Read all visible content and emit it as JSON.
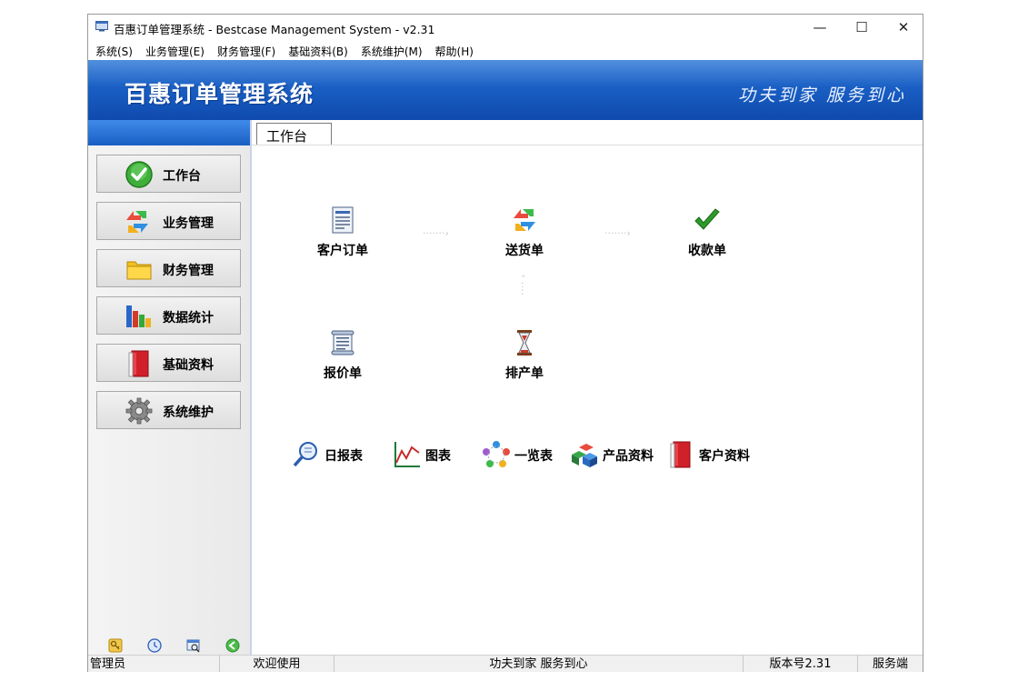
{
  "window": {
    "title": "百惠订单管理系统 - Bestcase Management System - v2.31",
    "controls": {
      "minimize": "—",
      "maximize": "☐",
      "close": "✕"
    }
  },
  "menu": [
    "系统(S)",
    "业务管理(E)",
    "财务管理(F)",
    "基础资料(B)",
    "系统维护(M)",
    "帮助(H)"
  ],
  "banner": {
    "title": "百惠订单管理系统",
    "slogan": "功夫到家 服务到心"
  },
  "sidebar": {
    "items": [
      {
        "label": "工作台",
        "icon": "check-circle-icon"
      },
      {
        "label": "业务管理",
        "icon": "exchange-arrows-icon"
      },
      {
        "label": "财务管理",
        "icon": "folder-icon"
      },
      {
        "label": "数据统计",
        "icon": "bar-chart-icon"
      },
      {
        "label": "基础资料",
        "icon": "red-book-icon"
      },
      {
        "label": "系统维护",
        "icon": "gear-icon"
      }
    ],
    "bottom_icons": [
      "key-icon",
      "clock-icon",
      "search-window-icon",
      "back-arrow-icon"
    ]
  },
  "workspace": {
    "tab": "工作台",
    "flow": {
      "customer_order": "客户订单",
      "delivery_note": "送货单",
      "receipt": "收款单",
      "quotation": "报价单",
      "production": "排产单"
    },
    "tools": [
      "日报表",
      "图表",
      "一览表",
      "产品资料",
      "客户资料"
    ]
  },
  "status": {
    "user": "管理员",
    "welcome": "欢迎使用",
    "slogan": "功夫到家 服务到心",
    "version": "版本号2.31",
    "mode": "服务端"
  },
  "colors": {
    "banner": "#1a5fc4",
    "accent": "#3f8bea"
  }
}
